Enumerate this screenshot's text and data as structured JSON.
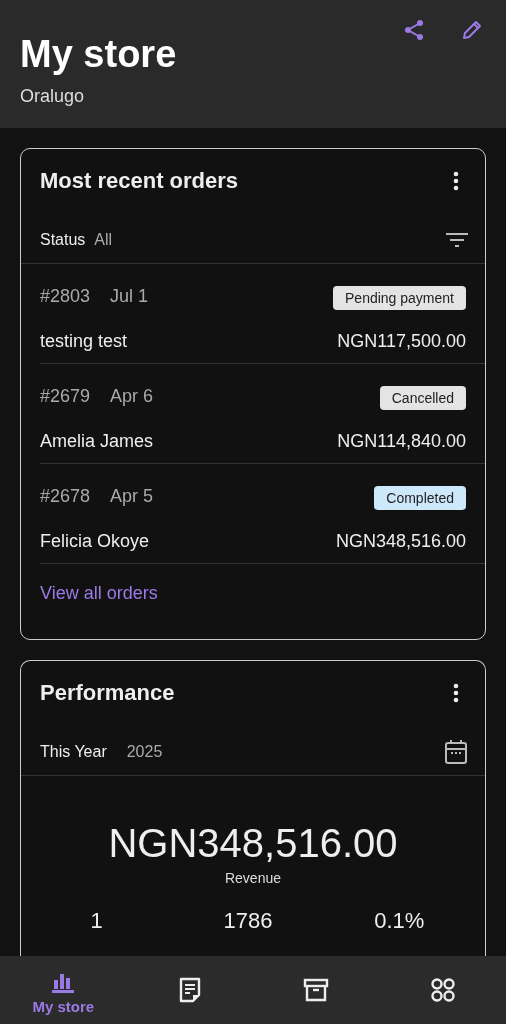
{
  "header": {
    "title": "My store",
    "subtitle": "Oralugo"
  },
  "orders": {
    "title": "Most recent orders",
    "filter_label": "Status",
    "filter_value": "All",
    "link": "View all orders",
    "rows": [
      {
        "number": "#2803",
        "date": "Jul 1",
        "customer": "testing test",
        "status": "Pending payment",
        "color": "#e4e4e4",
        "total": "NGN117,500.00"
      },
      {
        "number": "#2679",
        "date": "Apr 6",
        "customer": "Amelia James",
        "status": "Cancelled",
        "color": "#e4e4e4",
        "total": "NGN114,840.00"
      },
      {
        "number": "#2678",
        "date": "Apr 5",
        "customer": "Felicia Okoye",
        "status": "Completed",
        "color": "#cde8fb",
        "total": "NGN348,516.00"
      }
    ]
  },
  "performance": {
    "title": "Performance",
    "range_label": "This Year",
    "range_value": "2025",
    "revenue": "NGN348,516.00",
    "revenue_label": "Revenue",
    "stats": [
      {
        "value": "1"
      },
      {
        "value": "1786"
      },
      {
        "value": "0.1%"
      }
    ]
  },
  "nav": [
    {
      "kind": "store",
      "label": "My store",
      "selected": true
    },
    {
      "kind": "orders",
      "selected": false
    },
    {
      "kind": "products",
      "selected": false
    },
    {
      "kind": "more",
      "selected": false
    }
  ]
}
